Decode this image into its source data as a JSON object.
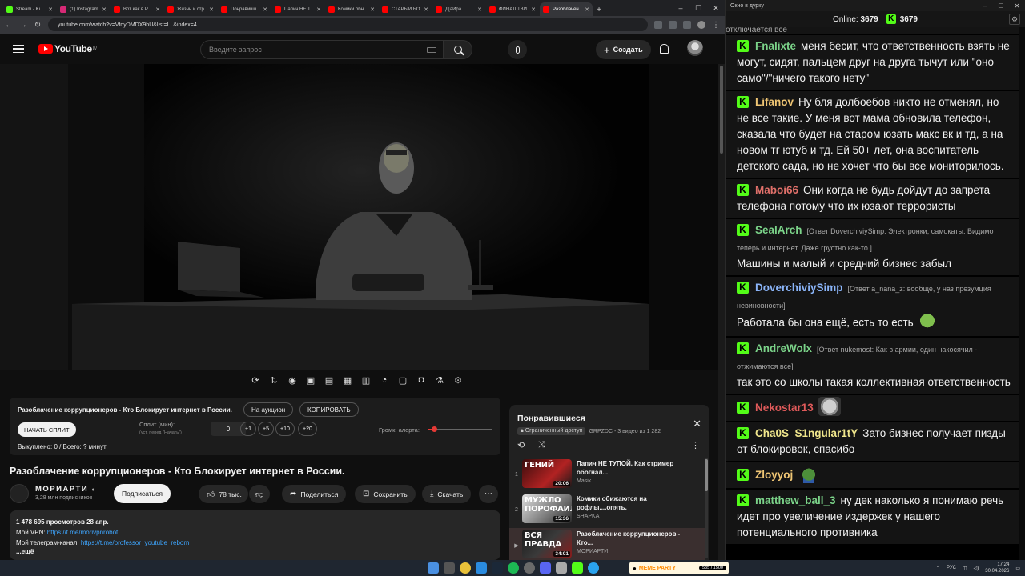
{
  "browser": {
    "tabs": [
      {
        "label": "Stream - Ki...",
        "color": "#53fc18"
      },
      {
        "label": "(1) Instagram",
        "color": "#d62976"
      },
      {
        "label": "Вот как в Р...",
        "color": "#ff0000"
      },
      {
        "label": "Жизнь и стр...",
        "color": "#ff0000"
      },
      {
        "label": "Понравивш...",
        "color": "#ff0000"
      },
      {
        "label": "Папич НЕ Т...",
        "color": "#ff0000"
      },
      {
        "label": "Комики обн...",
        "color": "#ff0000"
      },
      {
        "label": "СТАРЫЙ БО...",
        "color": "#ff0000"
      },
      {
        "label": "Д[аЙра",
        "color": "#ff0000"
      },
      {
        "label": "ФИНАЛ ТВИ...",
        "color": "#ff0000"
      },
      {
        "label": "Разоблачен...",
        "color": "#ff0000",
        "active": true
      }
    ],
    "url": "youtube.com/watch?v=VfoyDMDX9bU&list=LL&index=4"
  },
  "youtube": {
    "logo_text": "YouTube",
    "logo_region": "LV",
    "search_placeholder": "Введите запрос",
    "create_label": "Создать"
  },
  "auction": {
    "title": "Разоблачение коррупционеров - Кто Блокирует интернет в России.",
    "on_auction": "На аукцион",
    "copy": "КОПИРОВАТЬ",
    "start_split": "НАЧАТЬ СПЛИТ",
    "split_label": "Сплит (мин):",
    "split_hint": "(уст. перед \"Начать\")",
    "split_value": "0",
    "increments": [
      "+1",
      "+5",
      "+10",
      "+20"
    ],
    "alert_volume_label": "Громк. алерта:",
    "alert_volume": 0.1,
    "bought_text": "Выкуплено: 0 / Всего: ? минут"
  },
  "video": {
    "title": "Разоблачение коррупционеров - Кто Блокирует интернет в России.",
    "channel": "МОРИАРТИ",
    "subscribers": "3,28 млн подписчиков",
    "subscribe": "Подписаться",
    "likes": "78 тыс.",
    "share": "Поделиться",
    "save": "Сохранить",
    "download": "Скачать",
    "views_line": "1 478 695 просмотров  28 апр.",
    "vpn_label": "Мой VPN: ",
    "vpn_link": "https://t.me/morivpnrobot",
    "tg_label": "Мой телеграм-канал: ",
    "tg_link": "https://t.me/professor_youtube_reborn",
    "more": "...ещё"
  },
  "playlist": {
    "title": "Понравившиеся",
    "access": "Ограниченный доступ",
    "owner_info": "GRPZDC - 3 видео из 1 282",
    "items": [
      {
        "index": "1",
        "thumb_text": "ГЕНИЙ",
        "duration": "20:06",
        "title": "Папич НЕ ТУПОЙ. Как стример обогнал...",
        "channel": "Masik",
        "bg": "linear-gradient(135deg,#3a0d0d,#b22222 60%,#1a1a1a)"
      },
      {
        "index": "2",
        "thumb_text": "МУЖЛО ПОРОФАИЛА",
        "duration": "15:36",
        "title": "Комики обижаются на рофлы....опять.",
        "channel": "SHAPKA",
        "bg": "linear-gradient(135deg,#e0e0e0,#777 60%,#2a2a2a)"
      },
      {
        "index": "▶",
        "thumb_text": "ВСЯ ПРАВДА",
        "duration": "34:01",
        "title": "Разоблачение коррупционеров - Кто...",
        "channel": "МОРИАРТИ",
        "bg": "linear-gradient(135deg,#1a1a1a,#3a3a3a 50%,#8b1a1a)",
        "selected": true
      }
    ]
  },
  "chat": {
    "window_title": "Окно в дурку",
    "online_label": "Online:",
    "online_count": "3679",
    "kick_count": "3679",
    "partial_top": "отключается все",
    "messages": [
      {
        "user": "Fnalixte",
        "color": "#7bd389",
        "text": "меня бесит, что ответственность взять не могут, сидят, пальцем друг на друга тычут или \"оно само\"/\"ничего такого нету\""
      },
      {
        "user": "Lifanov",
        "color": "#f0c674",
        "text": "Ну бля долбоебов никто не отменял, но не все такие. У меня вот мама обновила телефон, сказала что будет на старом юзать макс вк и тд, а на новом тг ютуб и тд. Ей 50+ лет, она воспитатель детского сада, но не хочет что бы все мониторилось."
      },
      {
        "user": "Maboi66",
        "color": "#e0706a",
        "text": "Они когда не будь дойдут до запрета телефона потому что их юзают террористы"
      },
      {
        "user": "SealArch",
        "color": "#7bd389",
        "reply": "[Ответ DoverchiviySimp: Электронки, самокаты. Видимо теперь и интернет. Даже грустно как-то.]",
        "text": "Машины и малый и средний бизнес забыл"
      },
      {
        "user": "DoverchiviySimp",
        "color": "#8ab4f8",
        "reply": "[Ответ a_nana_z: вообще, у наз презумция невиновности]",
        "text": "Работала бы она ещё, есть то есть",
        "emote": "pepe"
      },
      {
        "user": "AndreWolx",
        "color": "#7bd389",
        "reply": "[Ответ nukemost: Как в армии, один накосячил - отжимаются все]",
        "text": "так это со школы такая коллективная ответственность"
      },
      {
        "user": "Nekostar13",
        "color": "#e05a5a",
        "text": "",
        "emote": "doge"
      },
      {
        "user": "Cha0S_S1ngular1tY",
        "color": "#f0e68c",
        "text": "Зато бизнес получает пизды от блокировок, спасибо"
      },
      {
        "user": "Zloyyoj",
        "color": "#f0c674",
        "text": "",
        "emote": "pepe2"
      },
      {
        "user": "matthew_ball_3",
        "color": "#7bd389",
        "text": "ну дек наколько я понимаю речь идет про увеличение издержек у нашего потенциального противника"
      }
    ]
  },
  "taskbar": {
    "meme_name": "MEME PARTY",
    "meme_count": "535 / 1500",
    "lang": "РУС",
    "time": "17:24",
    "date": "30.04.2026"
  },
  "colors": {
    "kick_green": "#53fc18",
    "youtube_red": "#ff0000",
    "link_blue": "#3ea6ff"
  }
}
